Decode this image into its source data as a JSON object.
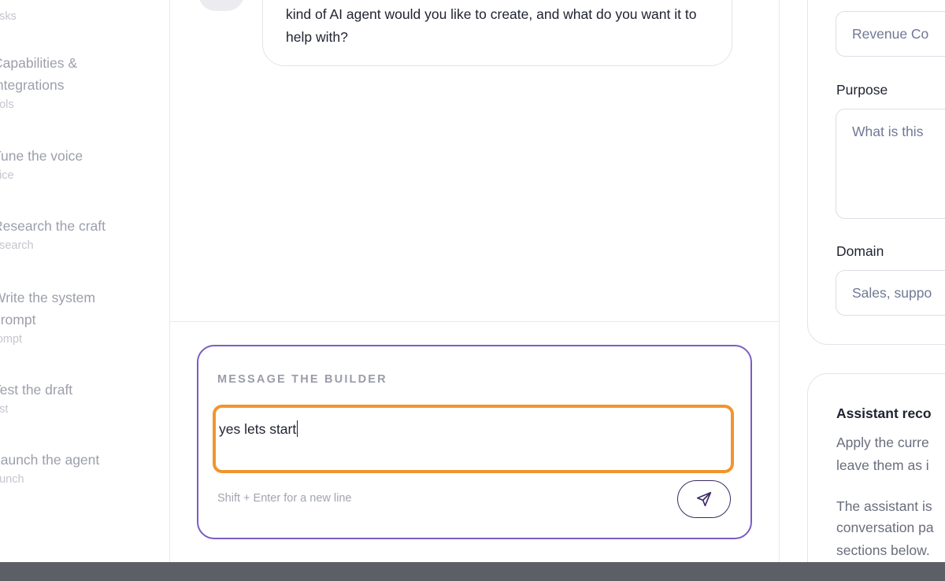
{
  "sidebar": {
    "steps": [
      {
        "title": "",
        "subtitle": "asks"
      },
      {
        "title": "Capabilities & integrations",
        "subtitle": "ools"
      },
      {
        "title": "Tune the voice",
        "subtitle": "oice"
      },
      {
        "title": "Research the craft",
        "subtitle": "esearch"
      },
      {
        "title": "Write the system prompt",
        "subtitle": "rompt"
      },
      {
        "title": "Test the draft",
        "subtitle": "est"
      },
      {
        "title": "Launch the agent",
        "subtitle": "aunch"
      }
    ]
  },
  "chat": {
    "assistant_message": "kind of AI agent would you like to create, and what do you want it to help with?",
    "composer": {
      "label": "MESSAGE THE BUILDER",
      "value": "yes lets start",
      "hint": "Shift + Enter for a new line",
      "send_icon": "paper-plane-icon"
    }
  },
  "form": {
    "name_value": "Revenue Co",
    "purpose_label": "Purpose",
    "purpose_placeholder": "What is this",
    "domain_label": "Domain",
    "domain_placeholder": "Sales, suppo"
  },
  "recommendations": {
    "title": "Assistant reco",
    "line1": "Apply the curre",
    "line2": "leave them as i",
    "line3": "The assistant is",
    "line4": "conversation pa",
    "line5": "sections below."
  },
  "colors": {
    "accent_purple": "#7b5cc4",
    "focus_orange": "#f0952d",
    "os_bar": "#5d5f66"
  }
}
